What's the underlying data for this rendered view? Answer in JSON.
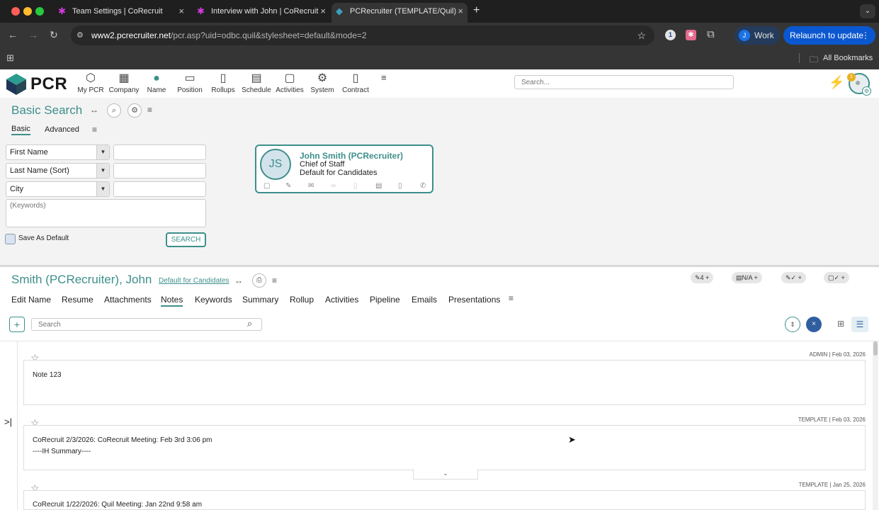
{
  "browser": {
    "tabs": [
      {
        "title": "Team Settings | CoRecruit"
      },
      {
        "title": "Interview with John | CoRecruit"
      },
      {
        "title": "PCRecruiter (TEMPLATE/Quil)"
      }
    ],
    "url_host": "www2.pcrecruiter.net",
    "url_path": "/pcr.asp?uid=odbc.quil&stylesheet=default&mode=2",
    "profile_label": "Work",
    "profile_initial": "J",
    "relaunch_label": "Relaunch to update",
    "bookmarks_label": "All Bookmarks"
  },
  "app": {
    "logo_text": "PCR",
    "nav": [
      {
        "label": "My PCR",
        "icon": "cube-icon"
      },
      {
        "label": "Company",
        "icon": "building-icon"
      },
      {
        "label": "Name",
        "icon": "person-icon"
      },
      {
        "label": "Position",
        "icon": "briefcase-icon"
      },
      {
        "label": "Rollups",
        "icon": "rollups-icon"
      },
      {
        "label": "Schedule",
        "icon": "calendar-icon"
      },
      {
        "label": "Activities",
        "icon": "chat-icon"
      },
      {
        "label": "System",
        "icon": "gear-icon"
      },
      {
        "label": "Contract",
        "icon": "document-icon"
      }
    ],
    "search_placeholder": "Search...",
    "notification_count": "1"
  },
  "basic_search": {
    "title": "Basic Search",
    "tabs": [
      "Basic",
      "Advanced"
    ],
    "fields": [
      "First Name",
      "Last Name (Sort)",
      "City"
    ],
    "keywords_placeholder": "(Keywords)",
    "save_default_label": "Save As Default",
    "search_button": "SEARCH"
  },
  "result_card": {
    "initials": "JS",
    "name": "John Smith (PCRecruiter)",
    "title": "Chief of Staff",
    "group": "Default for Candidates"
  },
  "record": {
    "name": "Smith (PCRecruiter), John",
    "group_link": "Default for Candidates",
    "pills": [
      "4",
      "N/A",
      "",
      ""
    ],
    "tabs": [
      "Edit Name",
      "Resume",
      "Attachments",
      "Notes",
      "Keywords",
      "Summary",
      "Rollup",
      "Activities",
      "Pipeline",
      "Emails",
      "Presentations"
    ],
    "active_tab": "Notes",
    "notes_search_placeholder": "Search"
  },
  "notes": [
    {
      "meta": "ADMIN | Feb 03, 2026",
      "line1": "Note 123",
      "line2": ""
    },
    {
      "meta": "TEMPLATE | Feb 03, 2026",
      "line1": "CoRecruit 2/3/2026: CoRecruit Meeting: Feb 3rd 3:06 pm",
      "line2": "----IH Summary----"
    },
    {
      "meta": "TEMPLATE | Jan 25, 2026",
      "line1": "CoRecruit 1/22/2026: Quil Meeting: Jan 22nd 9:58 am",
      "line2": ""
    }
  ],
  "colors": {
    "accent": "#3d8f8b",
    "chrome_dark": "#1f1f1f",
    "relaunch_bg": "#0b57d0"
  }
}
